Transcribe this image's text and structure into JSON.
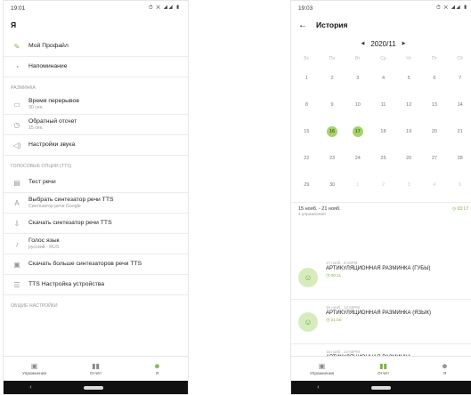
{
  "left": {
    "status_time": "19:01",
    "status_icons": "⏱ ✕ ◢◢ ▮",
    "title": "Я",
    "items": [
      {
        "icon": "pencil-icon",
        "glyph": "✎",
        "title": "Мой Профайл",
        "sub": ""
      },
      {
        "icon": "bell-icon",
        "glyph": "◔",
        "title": "Напоминание",
        "sub": ""
      }
    ],
    "section_warmup": "РАЗМИНКА",
    "warmup_items": [
      {
        "icon": "pause-icon",
        "glyph": "▭",
        "title": "Время перерывов",
        "sub": "30 сек."
      },
      {
        "icon": "timer-icon",
        "glyph": "◷",
        "title": "Обратный отсчет",
        "sub": "15 сек."
      },
      {
        "icon": "sound-icon",
        "glyph": "◁)",
        "title": "Настройки звука",
        "sub": ""
      }
    ],
    "section_voice": "ГОЛОСОВЫЕ ОПЦИИ (TTS)",
    "voice_items": [
      {
        "icon": "speech-test-icon",
        "glyph": "▤",
        "title": "Тест речи",
        "sub": ""
      },
      {
        "icon": "tts-select-icon",
        "glyph": "A",
        "title": "Выбрать синтезатор речи TTS",
        "sub": "Синтезатор речи Google"
      },
      {
        "icon": "download-icon",
        "glyph": "⇩",
        "title": "Скачать синтезатор речи TTS",
        "sub": ""
      },
      {
        "icon": "mic-icon",
        "glyph": "♪",
        "title": "Голос язык",
        "sub": "русский - RUS"
      },
      {
        "icon": "more-tts-icon",
        "glyph": "▣",
        "title": "Скачать больше синтезаторов речи TTS",
        "sub": ""
      },
      {
        "icon": "tts-settings-icon",
        "glyph": "☰",
        "title": "TTS Настройка устройства",
        "sub": ""
      }
    ],
    "section_general": "ОБЩИЕ НАСТРОЙКИ"
  },
  "nav": {
    "exercises": "Упражнения",
    "report": "Отчёт",
    "me": "Я"
  },
  "right": {
    "status_time": "19:03",
    "status_icons": "⏱ ✕ ◢◢ ▮",
    "title": "История",
    "month": "2020/11",
    "weekdays": [
      "Вс",
      "Пн",
      "Вт",
      "Ср",
      "Чт",
      "Пт",
      "Сб"
    ],
    "weeks": [
      [
        "1",
        "2",
        "3",
        "4",
        "5",
        "6",
        "7"
      ],
      [
        "8",
        "9",
        "10",
        "11",
        "12",
        "13",
        "14"
      ],
      [
        "15",
        "16",
        "17",
        "18",
        "19",
        "20",
        "21"
      ],
      [
        "22",
        "23",
        "24",
        "25",
        "26",
        "27",
        "28"
      ],
      [
        "29",
        "30",
        "1",
        "2",
        "3",
        "4",
        "5"
      ]
    ],
    "highlighted_days": [
      "16",
      "17"
    ],
    "week_range": "15 нояб. - 21 нояб.",
    "week_count": "4 упражнения",
    "week_total": "◷ 03:17",
    "entries": [
      {
        "date": "17 нояб., 6:19PM",
        "name": "АРТИКУЛЯЦИОННАЯ РАЗМИНКА (ГУБЫ)",
        "duration": "◷ 00:11"
      },
      {
        "date": "16 нояб., 12:50PM",
        "name": "АРТИКУЛЯЦИОННАЯ РАЗМИНКА (ЯЗЫК)",
        "duration": "◷ 01:00"
      },
      {
        "date": "16 нояб., 12:50PM",
        "name": "АРТИКУЛЯЦИОННАЯ РАЗМИНКА",
        "duration": ""
      }
    ]
  },
  "colors": {
    "accent": "#7cb342",
    "highlight": "#a5d36a"
  }
}
